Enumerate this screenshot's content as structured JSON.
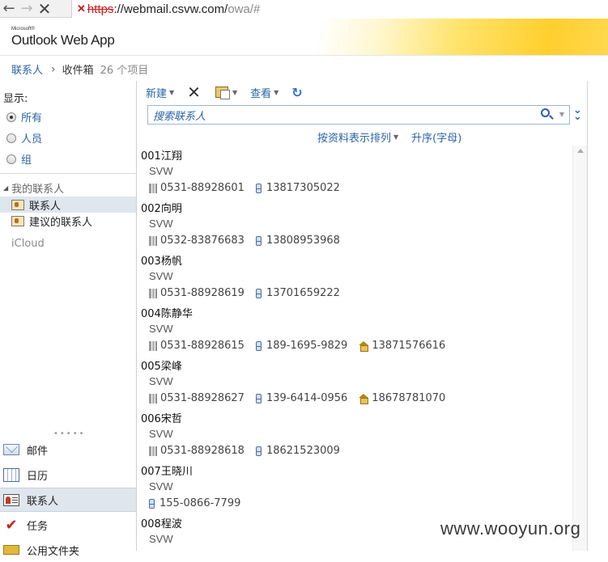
{
  "browser": {
    "url_https": "https",
    "url_rest": "://webmail.csvw.com/",
    "url_path": "owa/#"
  },
  "header": {
    "logo_ms": "Microsoft®",
    "logo_app": "Outlook Web App"
  },
  "breadcrumb": {
    "root": "联系人",
    "current": "收件箱",
    "count": "26 个项目"
  },
  "sidebar": {
    "show_label": "显示:",
    "filters": [
      {
        "label": "所有",
        "checked": true
      },
      {
        "label": "人员",
        "checked": false
      },
      {
        "label": "组",
        "checked": false
      }
    ],
    "folder_group": "我的联系人",
    "folders": [
      {
        "label": "联系人",
        "selected": true
      },
      {
        "label": "建议的联系人",
        "selected": false
      }
    ],
    "icloud": "iCloud",
    "grip": "•••••",
    "modules": [
      {
        "label": "邮件",
        "icon": "mail-icon"
      },
      {
        "label": "日历",
        "icon": "calendar-icon"
      },
      {
        "label": "联系人",
        "icon": "contacts-icon",
        "selected": true
      },
      {
        "label": "任务",
        "icon": "tasks-icon"
      },
      {
        "label": "公用文件夹",
        "icon": "public-folder-icon"
      }
    ]
  },
  "toolbar": {
    "new_label": "新建",
    "delete_symbol": "✕",
    "view_label": "查看",
    "refresh_symbol": "↻"
  },
  "search": {
    "placeholder": "搜索联系人"
  },
  "sort": {
    "arrange_label": "按资料表示排列",
    "order_label": "升序(字母)"
  },
  "contacts": [
    {
      "name": "001江翔",
      "company": "SVW",
      "work": "0531-88928601",
      "mobile": "13817305022",
      "home": ""
    },
    {
      "name": "002向明",
      "company": "SVW",
      "work": "0532-83876683",
      "mobile": "13808953968",
      "home": ""
    },
    {
      "name": "003杨帆",
      "company": "SVW",
      "work": "0531-88928619",
      "mobile": "13701659222",
      "home": ""
    },
    {
      "name": "004陈静华",
      "company": "SVW",
      "work": "0531-88928615",
      "mobile": "189-1695-9829",
      "home": "13871576616"
    },
    {
      "name": "005梁峰",
      "company": "SVW",
      "work": "0531-88928627",
      "mobile": "139-6414-0956",
      "home": "18678781070"
    },
    {
      "name": "006宋哲",
      "company": "SVW",
      "work": "0531-88928618",
      "mobile": "18621523009",
      "home": ""
    },
    {
      "name": "007王晓川",
      "company": "SVW",
      "work": "",
      "mobile": "155-0866-7799",
      "home": ""
    },
    {
      "name": "008程波",
      "company": "SVW",
      "work": "",
      "mobile": "",
      "home": ""
    }
  ],
  "watermark": "www.wooyun.org"
}
